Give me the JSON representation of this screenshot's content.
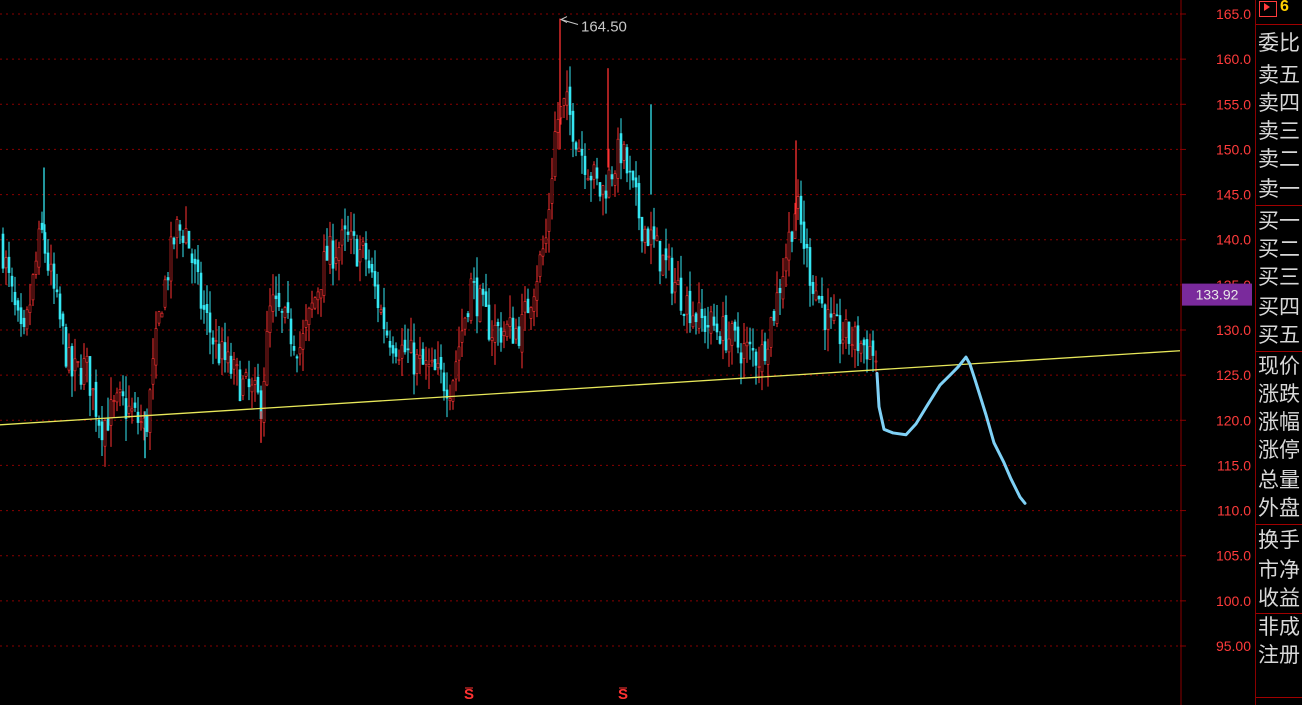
{
  "chart_data": {
    "type": "candlestick",
    "y_axis": {
      "ticks": [
        "165.0",
        "160.0",
        "155.0",
        "150.0",
        "145.0",
        "140.0",
        "135.0",
        "130.0",
        "125.0",
        "120.0",
        "115.0",
        "110.0",
        "105.0",
        "100.0",
        "95.00"
      ],
      "min": 92.5,
      "max": 166.5
    },
    "current_price": "133.92",
    "annotations": {
      "high_label": "164.50",
      "markers": [
        "S",
        "S"
      ]
    },
    "colors": {
      "up": "#ff3232",
      "down": "#35e6f2",
      "grid": "#8a0000",
      "axis_text": "#ff3b3b",
      "support_line": "#e8e85a",
      "drawn_path": "#7fd1f6",
      "price_tag_bg": "#7a2a9c"
    },
    "support_line": {
      "from": [
        0,
        119.5
      ],
      "to": [
        1180,
        127.7
      ]
    },
    "drawn_projection": [
      [
        877,
        125.2
      ],
      [
        879,
        121.5
      ],
      [
        884,
        119.0
      ],
      [
        893,
        118.6
      ],
      [
        906,
        118.4
      ],
      [
        916,
        119.6
      ],
      [
        927,
        121.6
      ],
      [
        940,
        123.9
      ],
      [
        950,
        125.0
      ],
      [
        958,
        125.9
      ],
      [
        966,
        127.0
      ],
      [
        970,
        126.2
      ],
      [
        975,
        124.5
      ],
      [
        986,
        120.6
      ],
      [
        994,
        117.5
      ],
      [
        1004,
        115.3
      ],
      [
        1011,
        113.5
      ],
      [
        1020,
        111.5
      ],
      [
        1025,
        110.8
      ]
    ]
  },
  "panel": {
    "header_number": "6",
    "rows": [
      "委比",
      "卖五",
      "卖四",
      "卖三",
      "卖二",
      "卖一",
      "买一",
      "买二",
      "买三",
      "买四",
      "买五",
      "现价",
      "涨跌",
      "涨幅",
      "涨停",
      "总量",
      "外盘",
      "换手",
      "市净",
      "收益",
      "非成",
      "注册"
    ]
  }
}
